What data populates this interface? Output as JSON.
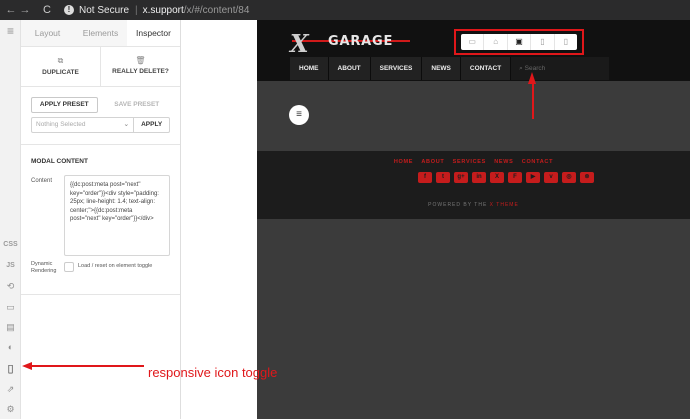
{
  "browser": {
    "back_icon": "←",
    "forward_icon": "→",
    "reload_icon": "C",
    "security_label": "Not Secure",
    "url_host": "x.support",
    "url_path": "/x/#/content/84"
  },
  "rail": {
    "menu_icon": "≡",
    "css_label": "CSS",
    "js_label": "JS",
    "history_icon": "⟲",
    "layout_icon": "▭",
    "templates_icon": "▤",
    "half_circle_icon": "◐",
    "responsive_icon": "▯",
    "external_icon": "⇗",
    "settings_icon": "⚙"
  },
  "inspector": {
    "tabs": [
      {
        "label": "Layout",
        "active": false
      },
      {
        "label": "Elements",
        "active": false
      },
      {
        "label": "Inspector",
        "active": true
      }
    ],
    "duplicate_label": "DUPLICATE",
    "delete_label": "REALLY DELETE?",
    "apply_preset_label": "APPLY PRESET",
    "save_preset_label": "SAVE PRESET",
    "preset_select_value": "Nothing Selected",
    "apply_label": "APPLY",
    "section_title": "MODAL CONTENT",
    "content_label": "Content",
    "content_value": "{{dc:post:meta post=\"next\" key=\"order\"}}<div style=\"padding: 25px; line-height: 1.4; text-align: center;\">{{dc:post:meta post=\"next\" key=\"order\"}}</div>",
    "dynamic_label": "Dynamic Rendering",
    "dynamic_option": "Load / reset on element toggle"
  },
  "site": {
    "logo_mark": "X",
    "logo_word": "GARAGE",
    "nav": [
      "HOME",
      "ABOUT",
      "SERVICES",
      "NEWS",
      "CONTACT"
    ],
    "search_placeholder": "Search",
    "footer_links": [
      "HOME",
      "ABOUT",
      "SERVICES",
      "NEWS",
      "CONTACT"
    ],
    "social": [
      {
        "icon": "facebook-icon",
        "glyph": "f"
      },
      {
        "icon": "twitter-icon",
        "glyph": "t"
      },
      {
        "icon": "google-plus-icon",
        "glyph": "g+"
      },
      {
        "icon": "linkedin-icon",
        "glyph": "in"
      },
      {
        "icon": "xing-icon",
        "glyph": "X"
      },
      {
        "icon": "foursquare-icon",
        "glyph": "F"
      },
      {
        "icon": "youtube-icon",
        "glyph": "▶"
      },
      {
        "icon": "vimeo-icon",
        "glyph": "v"
      },
      {
        "icon": "instagram-icon",
        "glyph": "◎"
      },
      {
        "icon": "rss-icon",
        "glyph": "⊚"
      }
    ],
    "powered_prefix": "POWERED BY THE",
    "powered_brand": "X THEME"
  },
  "responsive_devices": [
    {
      "name": "desktop-xl-icon",
      "glyph": "▭",
      "active": false
    },
    {
      "name": "laptop-icon",
      "glyph": "⌂",
      "active": false
    },
    {
      "name": "tablet-landscape-icon",
      "glyph": "▣",
      "active": true
    },
    {
      "name": "tablet-portrait-icon",
      "glyph": "▯",
      "active": false
    },
    {
      "name": "phone-icon",
      "glyph": "▯",
      "active": false
    }
  ],
  "annotation": {
    "text": "responsive icon toggle",
    "color": "#e0171a"
  },
  "colors": {
    "brand_red": "#c51c1c",
    "site_header": "#111111",
    "preview_bg": "#3b3b3b"
  }
}
